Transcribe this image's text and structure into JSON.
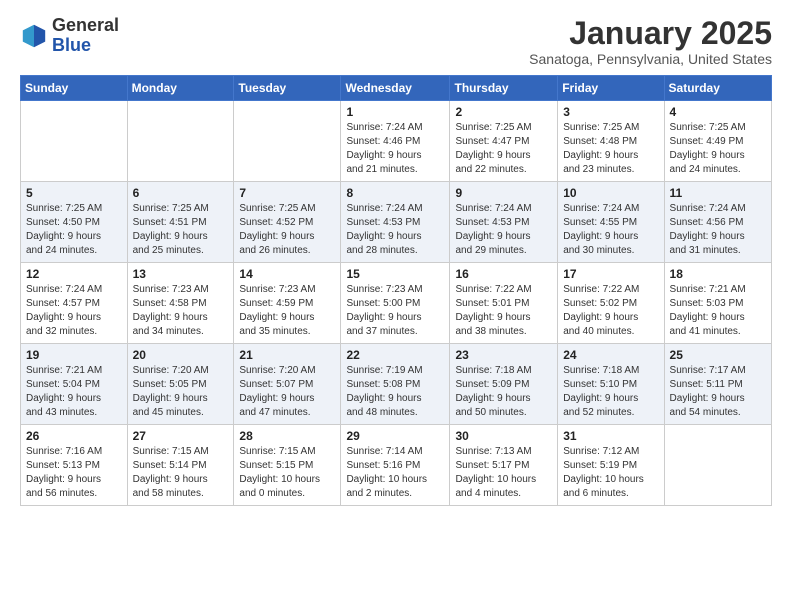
{
  "header": {
    "logo_general": "General",
    "logo_blue": "Blue",
    "month_title": "January 2025",
    "subtitle": "Sanatoga, Pennsylvania, United States"
  },
  "weekdays": [
    "Sunday",
    "Monday",
    "Tuesday",
    "Wednesday",
    "Thursday",
    "Friday",
    "Saturday"
  ],
  "weeks": [
    [
      {
        "day": "",
        "info": ""
      },
      {
        "day": "",
        "info": ""
      },
      {
        "day": "",
        "info": ""
      },
      {
        "day": "1",
        "info": "Sunrise: 7:24 AM\nSunset: 4:46 PM\nDaylight: 9 hours\nand 21 minutes."
      },
      {
        "day": "2",
        "info": "Sunrise: 7:25 AM\nSunset: 4:47 PM\nDaylight: 9 hours\nand 22 minutes."
      },
      {
        "day": "3",
        "info": "Sunrise: 7:25 AM\nSunset: 4:48 PM\nDaylight: 9 hours\nand 23 minutes."
      },
      {
        "day": "4",
        "info": "Sunrise: 7:25 AM\nSunset: 4:49 PM\nDaylight: 9 hours\nand 24 minutes."
      }
    ],
    [
      {
        "day": "5",
        "info": "Sunrise: 7:25 AM\nSunset: 4:50 PM\nDaylight: 9 hours\nand 24 minutes."
      },
      {
        "day": "6",
        "info": "Sunrise: 7:25 AM\nSunset: 4:51 PM\nDaylight: 9 hours\nand 25 minutes."
      },
      {
        "day": "7",
        "info": "Sunrise: 7:25 AM\nSunset: 4:52 PM\nDaylight: 9 hours\nand 26 minutes."
      },
      {
        "day": "8",
        "info": "Sunrise: 7:24 AM\nSunset: 4:53 PM\nDaylight: 9 hours\nand 28 minutes."
      },
      {
        "day": "9",
        "info": "Sunrise: 7:24 AM\nSunset: 4:53 PM\nDaylight: 9 hours\nand 29 minutes."
      },
      {
        "day": "10",
        "info": "Sunrise: 7:24 AM\nSunset: 4:55 PM\nDaylight: 9 hours\nand 30 minutes."
      },
      {
        "day": "11",
        "info": "Sunrise: 7:24 AM\nSunset: 4:56 PM\nDaylight: 9 hours\nand 31 minutes."
      }
    ],
    [
      {
        "day": "12",
        "info": "Sunrise: 7:24 AM\nSunset: 4:57 PM\nDaylight: 9 hours\nand 32 minutes."
      },
      {
        "day": "13",
        "info": "Sunrise: 7:23 AM\nSunset: 4:58 PM\nDaylight: 9 hours\nand 34 minutes."
      },
      {
        "day": "14",
        "info": "Sunrise: 7:23 AM\nSunset: 4:59 PM\nDaylight: 9 hours\nand 35 minutes."
      },
      {
        "day": "15",
        "info": "Sunrise: 7:23 AM\nSunset: 5:00 PM\nDaylight: 9 hours\nand 37 minutes."
      },
      {
        "day": "16",
        "info": "Sunrise: 7:22 AM\nSunset: 5:01 PM\nDaylight: 9 hours\nand 38 minutes."
      },
      {
        "day": "17",
        "info": "Sunrise: 7:22 AM\nSunset: 5:02 PM\nDaylight: 9 hours\nand 40 minutes."
      },
      {
        "day": "18",
        "info": "Sunrise: 7:21 AM\nSunset: 5:03 PM\nDaylight: 9 hours\nand 41 minutes."
      }
    ],
    [
      {
        "day": "19",
        "info": "Sunrise: 7:21 AM\nSunset: 5:04 PM\nDaylight: 9 hours\nand 43 minutes."
      },
      {
        "day": "20",
        "info": "Sunrise: 7:20 AM\nSunset: 5:05 PM\nDaylight: 9 hours\nand 45 minutes."
      },
      {
        "day": "21",
        "info": "Sunrise: 7:20 AM\nSunset: 5:07 PM\nDaylight: 9 hours\nand 47 minutes."
      },
      {
        "day": "22",
        "info": "Sunrise: 7:19 AM\nSunset: 5:08 PM\nDaylight: 9 hours\nand 48 minutes."
      },
      {
        "day": "23",
        "info": "Sunrise: 7:18 AM\nSunset: 5:09 PM\nDaylight: 9 hours\nand 50 minutes."
      },
      {
        "day": "24",
        "info": "Sunrise: 7:18 AM\nSunset: 5:10 PM\nDaylight: 9 hours\nand 52 minutes."
      },
      {
        "day": "25",
        "info": "Sunrise: 7:17 AM\nSunset: 5:11 PM\nDaylight: 9 hours\nand 54 minutes."
      }
    ],
    [
      {
        "day": "26",
        "info": "Sunrise: 7:16 AM\nSunset: 5:13 PM\nDaylight: 9 hours\nand 56 minutes."
      },
      {
        "day": "27",
        "info": "Sunrise: 7:15 AM\nSunset: 5:14 PM\nDaylight: 9 hours\nand 58 minutes."
      },
      {
        "day": "28",
        "info": "Sunrise: 7:15 AM\nSunset: 5:15 PM\nDaylight: 10 hours\nand 0 minutes."
      },
      {
        "day": "29",
        "info": "Sunrise: 7:14 AM\nSunset: 5:16 PM\nDaylight: 10 hours\nand 2 minutes."
      },
      {
        "day": "30",
        "info": "Sunrise: 7:13 AM\nSunset: 5:17 PM\nDaylight: 10 hours\nand 4 minutes."
      },
      {
        "day": "31",
        "info": "Sunrise: 7:12 AM\nSunset: 5:19 PM\nDaylight: 10 hours\nand 6 minutes."
      },
      {
        "day": "",
        "info": ""
      }
    ]
  ]
}
